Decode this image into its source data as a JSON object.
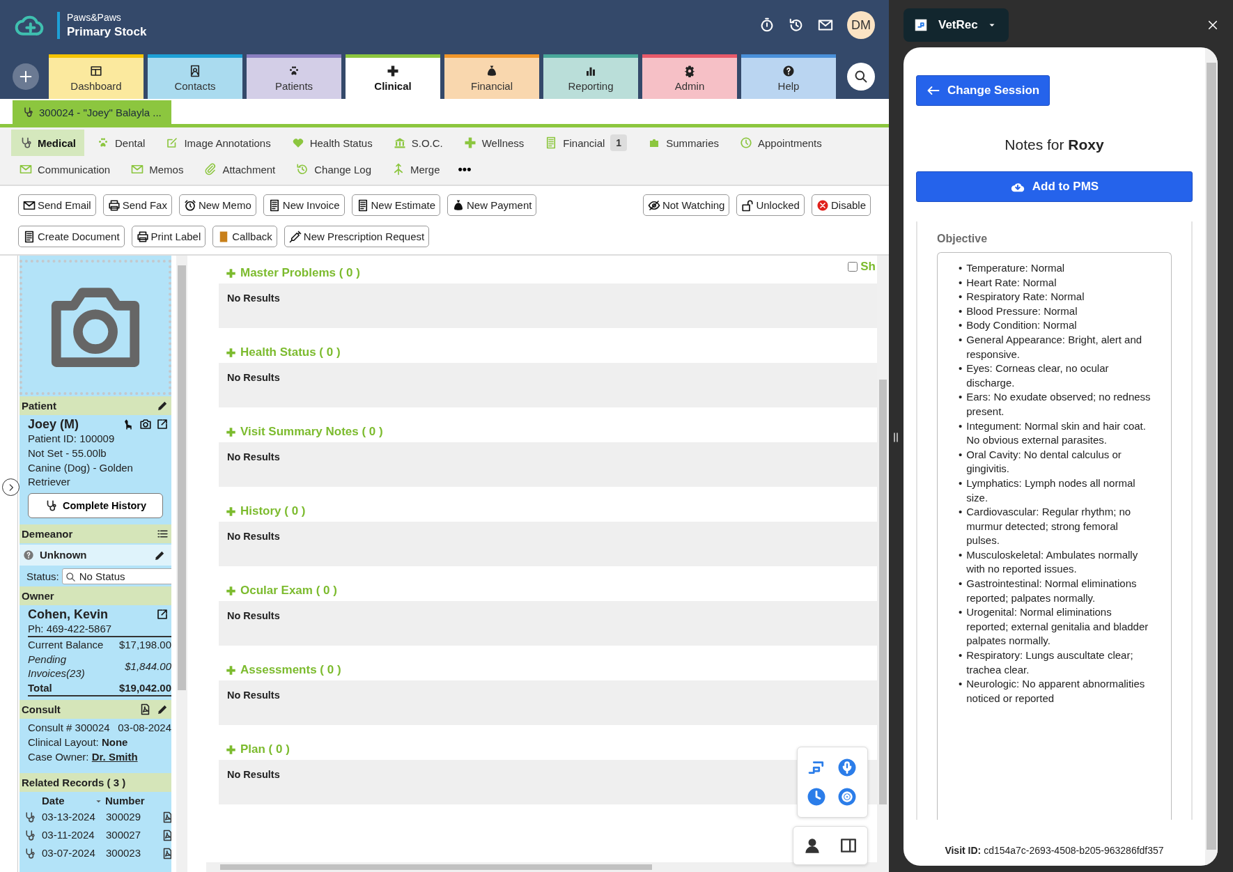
{
  "header": {
    "org": "Paws&Paws",
    "location": "Primary Stock",
    "avatar": "DM"
  },
  "nav_tabs": [
    {
      "label": "Dashboard",
      "selected": false,
      "color": "#f5c400"
    },
    {
      "label": "Contacts",
      "selected": false,
      "color": "#1ea0d6"
    },
    {
      "label": "Patients",
      "selected": false,
      "color": "#8a7fc0"
    },
    {
      "label": "Clinical",
      "selected": true,
      "color": "#8cc63f"
    },
    {
      "label": "Financial",
      "selected": false,
      "color": "#f0962a"
    },
    {
      "label": "Reporting",
      "selected": false,
      "color": "#4aa89a"
    },
    {
      "label": "Admin",
      "selected": false,
      "color": "#e85a6a"
    },
    {
      "label": "Help",
      "selected": false,
      "color": "#4a90d9"
    }
  ],
  "record_tab": {
    "label": "300024 - \"Joey\" Balayla ..."
  },
  "sub_tab_rows": [
    [
      {
        "label": "Medical",
        "selected": true
      },
      {
        "label": "Dental",
        "selected": false
      },
      {
        "label": "Image Annotations",
        "selected": false
      },
      {
        "label": "Health Status",
        "selected": false
      },
      {
        "label": "S.O.C.",
        "selected": false
      },
      {
        "label": "Wellness",
        "selected": false
      },
      {
        "label": "Financial",
        "selected": false,
        "badge": "1"
      },
      {
        "label": "Summaries",
        "selected": false
      },
      {
        "label": "Appointments",
        "selected": false
      }
    ],
    [
      {
        "label": "Communication",
        "selected": false
      },
      {
        "label": "Memos",
        "selected": false
      },
      {
        "label": "Attachment",
        "selected": false
      },
      {
        "label": "Change Log",
        "selected": false
      },
      {
        "label": "Merge",
        "selected": false
      }
    ]
  ],
  "more_tabs": "•••",
  "toolbar": {
    "left": [
      "Send Email",
      "Send Fax",
      "New Memo",
      "New Invoice",
      "New Estimate",
      "New Payment"
    ],
    "right": [
      "Not Watching",
      "Unlocked",
      "Disable"
    ],
    "second_row": [
      "Create Document",
      "Print Label",
      "Callback",
      "New Prescription Request"
    ]
  },
  "sidebar": {
    "patient": {
      "heading": "Patient",
      "name": "Joey (M)",
      "lines": [
        "Patient ID: 100009",
        "Not Set - 55.00lb",
        "Canine (Dog) - Golden Retriever"
      ],
      "history_button": "Complete History"
    },
    "demeanor": {
      "heading": "Demeanor",
      "value": "Unknown",
      "status_label": "Status:",
      "status_value": "No Status"
    },
    "owner": {
      "heading": "Owner",
      "name": "Cohen, Kevin",
      "phone": "Ph: 469-422-5867",
      "balances": [
        {
          "label": "Current Balance",
          "amount": "$17,198.00",
          "kind": "normal"
        },
        {
          "label": "Pending Invoices(23)",
          "amount": "$1,844.00",
          "kind": "pending"
        },
        {
          "label": "Total",
          "amount": "$19,042.00",
          "kind": "total"
        }
      ]
    },
    "consult": {
      "heading": "Consult",
      "number": "Consult # 300024",
      "date": "03-08-2024",
      "layout_label": "Clinical Layout:",
      "layout": "None",
      "owner_label": "Case Owner:",
      "owner": "Dr. Smith"
    },
    "related": {
      "heading": "Related Records ( 3 )",
      "columns": [
        "Date",
        "Number"
      ],
      "rows": [
        {
          "date": "03-13-2024",
          "number": "300029"
        },
        {
          "date": "03-11-2024",
          "number": "300027"
        },
        {
          "date": "03-07-2024",
          "number": "300023"
        }
      ]
    }
  },
  "show_checkbox": {
    "label": "Sh",
    "checked": false
  },
  "sections": [
    {
      "title": "Master Problems ( 0 )",
      "message": "No Results"
    },
    {
      "title": "Health Status ( 0 )",
      "message": "No Results"
    },
    {
      "title": "Visit Summary Notes ( 0 )",
      "message": "No Results"
    },
    {
      "title": "History ( 0 )",
      "message": "No Results"
    },
    {
      "title": "Ocular Exam ( 0 )",
      "message": "No Results"
    },
    {
      "title": "Assessments ( 0 )",
      "message": "No Results"
    },
    {
      "title": "Plan ( 0 )",
      "message": "No Results"
    }
  ],
  "vetrec": {
    "app": "VetRec",
    "bullet": "•",
    "change_session": "Change Session",
    "title_prefix": "Notes for",
    "patient": "Roxy",
    "add_button": "Add to PMS",
    "section": "Objective",
    "items": [
      "Temperature: Normal",
      "Heart Rate: Normal",
      "Respiratory Rate: Normal",
      "Blood Pressure: Normal",
      "Body Condition: Normal",
      "General Appearance: Bright, alert and responsive.",
      "Eyes: Corneas clear, no ocular discharge.",
      "Ears: No exudate observed; no redness present.",
      "Integument: Normal skin and hair coat. No obvious external parasites.",
      "Oral Cavity: No dental calculus or gingivitis.",
      "Lymphatics: Lymph nodes all normal size.",
      "Cardiovascular: Regular rhythm; no murmur detected; strong femoral pulses.",
      "Musculoskeletal: Ambulates normally with no reported issues.",
      "Gastrointestinal: Normal eliminations reported; palpates normally.",
      "Urogenital: Normal eliminations reported; external genitalia and bladder palpates normally.",
      "Respiratory: Lungs auscultate clear; trachea clear.",
      "Neurologic: No apparent abnormalities noticed or reported"
    ],
    "visit_label": "Visit ID:",
    "visit_id": "cd154a7c-2693-4508-b205-963286fdf357"
  }
}
